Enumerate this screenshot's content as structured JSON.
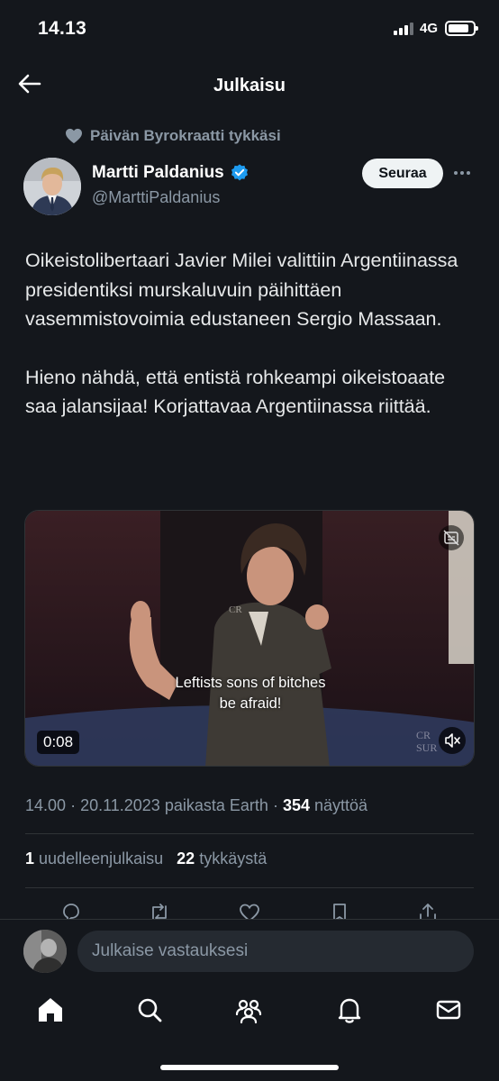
{
  "status_bar": {
    "time": "14.13",
    "network": "4G"
  },
  "header": {
    "title": "Julkaisu"
  },
  "social_context": {
    "text": "Päivän Byrokraatti tykkäsi"
  },
  "author": {
    "name": "Martti Paldanius",
    "handle": "@MarttiPaldanius",
    "verified": true,
    "follow_label": "Seuraa"
  },
  "tweet": {
    "paragraph_1": "Oikeistolibertaari Javier Milei valittiin Argentiinassa presidentiksi murskaluvuin päihittäen vasemmistovoimia edustaneen Sergio Massaan.",
    "paragraph_2": "Hieno nähdä, että entistä rohkeampi oikeistoaate saa jalansijaa! Korjattavaa Argentiinassa riittää."
  },
  "video": {
    "caption_line_1": "Leftists sons of bitches",
    "caption_line_2": "be afraid!",
    "duration": "0:08",
    "watermark_line_1": "CR",
    "watermark_line_2": "SUR"
  },
  "meta": {
    "time": "14.00",
    "date": "20.11.2023",
    "location": "paikasta Earth",
    "views_count": "354",
    "views_label": "näyttöä"
  },
  "stats": {
    "reposts_count": "1",
    "reposts_label": "uudelleenjulkaisu",
    "likes_count": "22",
    "likes_label": "tykkäystä"
  },
  "reply": {
    "placeholder": "Julkaise vastauksesi"
  },
  "colors": {
    "background": "#14171c",
    "text": "#e7e9ea",
    "muted": "#8b98a5",
    "verified": "#1d9bf0",
    "divider": "#2f3336"
  },
  "icons": [
    "back-arrow-icon",
    "heart-icon",
    "verified-badge-icon",
    "more-icon",
    "caption-icon",
    "mute-icon",
    "reply-icon",
    "repost-icon",
    "like-icon",
    "bookmark-icon",
    "share-icon",
    "home-icon",
    "search-icon",
    "communities-icon",
    "notifications-icon",
    "messages-icon"
  ]
}
